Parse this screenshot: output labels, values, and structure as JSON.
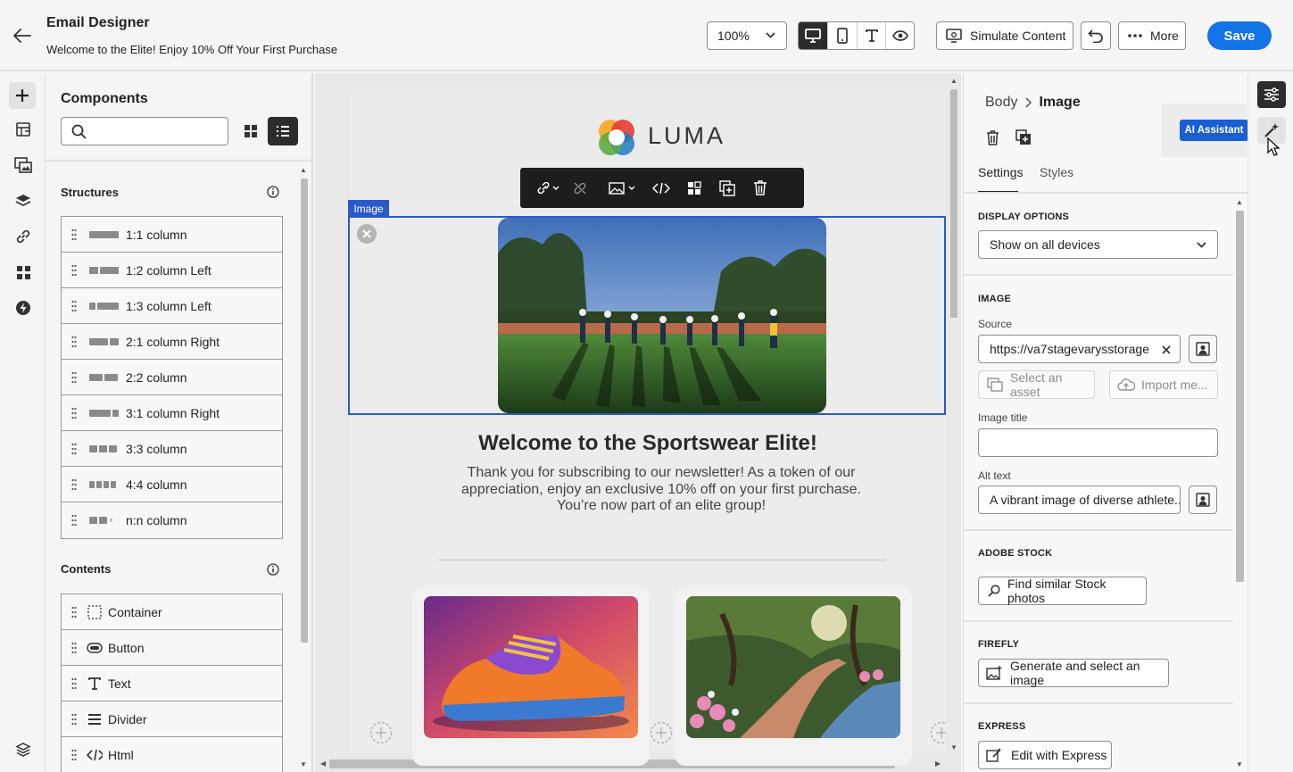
{
  "header": {
    "title": "Email Designer",
    "subtitle": "Welcome to the Elite! Enjoy 10% Off Your First Purchase",
    "zoom": "100%",
    "simulate_label": "Simulate Content",
    "more_label": "More",
    "save_label": "Save"
  },
  "components": {
    "title": "Components",
    "search_placeholder": "",
    "structures_title": "Structures",
    "structures": [
      "1:1 column",
      "1:2 column Left",
      "1:3 column Left",
      "2:1 column Right",
      "2:2 column",
      "3:1 column Right",
      "3:3 column",
      "4:4 column",
      "n:n column"
    ],
    "contents_title": "Contents",
    "contents": [
      "Container",
      "Button",
      "Text",
      "Divider",
      "Html"
    ]
  },
  "canvas": {
    "logo_text": "LUMA",
    "image_tag": "Image",
    "headline": "Welcome to the Sportswear Elite!",
    "body_lines": [
      "Thank you for subscribing to our newsletter! As a token of our",
      "appreciation, enjoy an exclusive 10% off on your first purchase.",
      "You’re now part of an elite group!"
    ]
  },
  "props": {
    "breadcrumb_parent": "Body",
    "breadcrumb_current": "Image",
    "tab_settings": "Settings",
    "tab_styles": "Styles",
    "ai_assistant_label": "AI Assistant",
    "display_options_title": "DISPLAY OPTIONS",
    "display_options_value": "Show on all devices",
    "image_title": "IMAGE",
    "source_label": "Source",
    "source_value": "https://va7stagevarysstorage....",
    "select_asset": "Select an asset",
    "import_media": "Import me...",
    "image_title_label": "Image title",
    "image_title_value": "",
    "alt_text_label": "Alt text",
    "alt_text_value": "A vibrant image of diverse athlete...",
    "adobe_stock_title": "ADOBE STOCK",
    "find_stock": "Find similar Stock photos",
    "firefly_title": "FIREFLY",
    "generate_image": "Generate and select an image",
    "express_title": "EXPRESS",
    "edit_express": "Edit with Express"
  },
  "colors": {
    "accent": "#1473e6",
    "save_bg": "#1473e6",
    "ai_bg": "#1a5fd1",
    "selection": "#2a5ac8"
  }
}
